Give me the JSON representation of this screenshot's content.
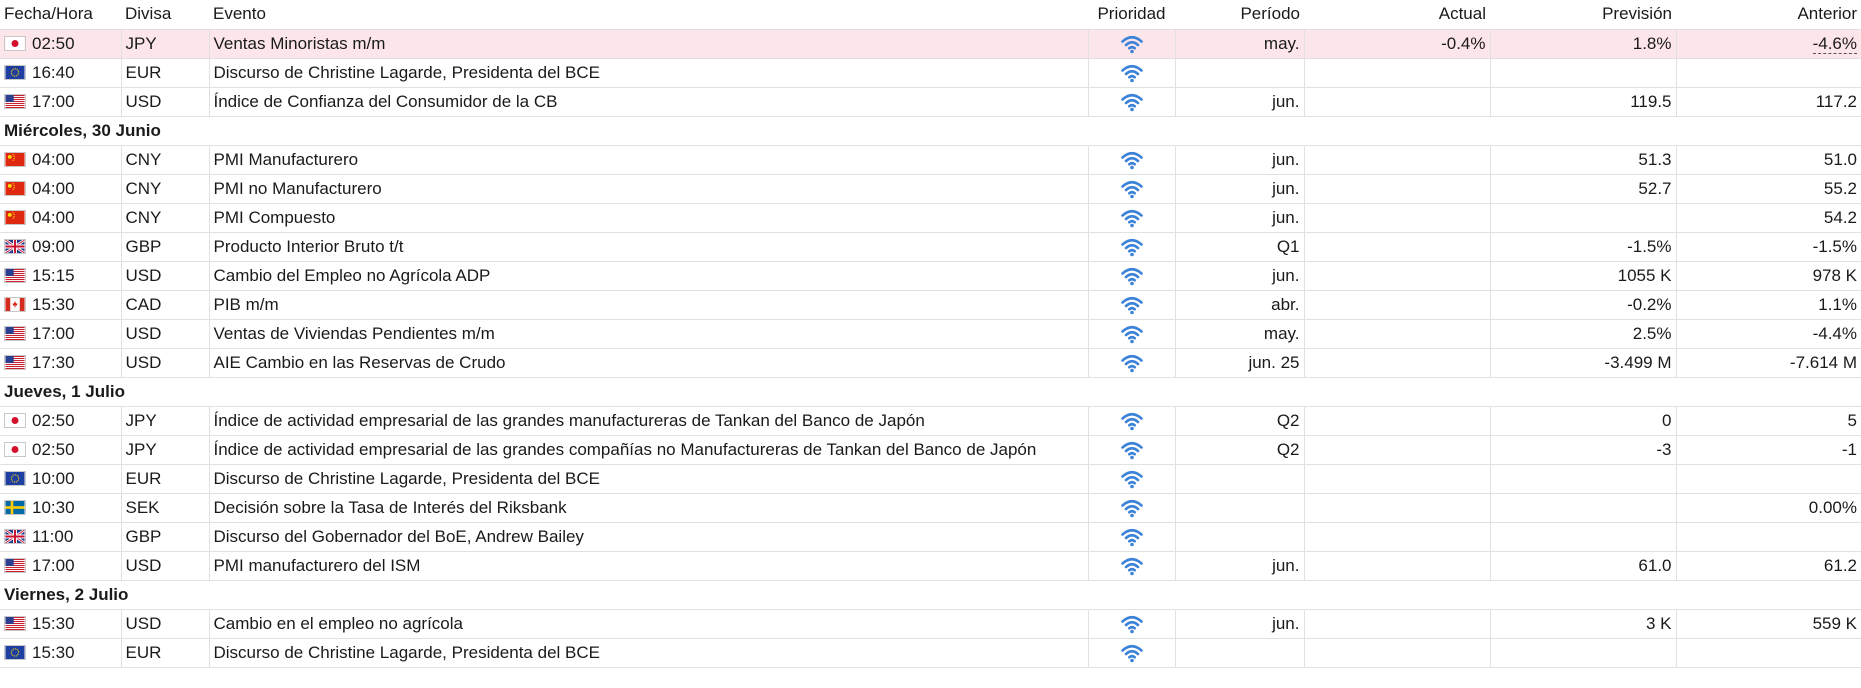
{
  "headers": {
    "datetime": "Fecha/Hora",
    "currency": "Divisa",
    "event": "Evento",
    "priority": "Prioridad",
    "period": "Período",
    "actual": "Actual",
    "forecast": "Previsión",
    "previous": "Anterior"
  },
  "colors": {
    "highlight_row": "#fde6ea",
    "priority_icon": "#3b82d8"
  },
  "rows": [
    {
      "type": "event",
      "flag": "jp",
      "time": "02:50",
      "currency": "JPY",
      "event": "Ventas Minoristas m/m",
      "period": "may.",
      "actual": "-0.4%",
      "forecast": "1.8%",
      "previous": "-4.6%",
      "highlight": true
    },
    {
      "type": "event",
      "flag": "eu",
      "time": "16:40",
      "currency": "EUR",
      "event": "Discurso de Christine Lagarde, Presidenta del BCE",
      "period": "",
      "actual": "",
      "forecast": "",
      "previous": ""
    },
    {
      "type": "event",
      "flag": "us",
      "time": "17:00",
      "currency": "USD",
      "event": "Índice de Confianza del Consumidor de la CB",
      "period": "jun.",
      "actual": "",
      "forecast": "119.5",
      "previous": "117.2"
    },
    {
      "type": "day",
      "label": "Miércoles, 30 Junio"
    },
    {
      "type": "event",
      "flag": "cn",
      "time": "04:00",
      "currency": "CNY",
      "event": "PMI Manufacturero",
      "period": "jun.",
      "actual": "",
      "forecast": "51.3",
      "previous": "51.0"
    },
    {
      "type": "event",
      "flag": "cn",
      "time": "04:00",
      "currency": "CNY",
      "event": "PMI no Manufacturero",
      "period": "jun.",
      "actual": "",
      "forecast": "52.7",
      "previous": "55.2"
    },
    {
      "type": "event",
      "flag": "cn",
      "time": "04:00",
      "currency": "CNY",
      "event": "PMI Compuesto",
      "period": "jun.",
      "actual": "",
      "forecast": "",
      "previous": "54.2"
    },
    {
      "type": "event",
      "flag": "gb",
      "time": "09:00",
      "currency": "GBP",
      "event": "Producto Interior Bruto t/t",
      "period": "Q1",
      "actual": "",
      "forecast": "-1.5%",
      "previous": "-1.5%"
    },
    {
      "type": "event",
      "flag": "us",
      "time": "15:15",
      "currency": "USD",
      "event": "Cambio del Empleo no Agrícola ADP",
      "period": "jun.",
      "actual": "",
      "forecast": "1055 K",
      "previous": "978 K"
    },
    {
      "type": "event",
      "flag": "ca",
      "time": "15:30",
      "currency": "CAD",
      "event": "PIB m/m",
      "period": "abr.",
      "actual": "",
      "forecast": "-0.2%",
      "previous": "1.1%"
    },
    {
      "type": "event",
      "flag": "us",
      "time": "17:00",
      "currency": "USD",
      "event": "Ventas de Viviendas Pendientes m/m",
      "period": "may.",
      "actual": "",
      "forecast": "2.5%",
      "previous": "-4.4%"
    },
    {
      "type": "event",
      "flag": "us",
      "time": "17:30",
      "currency": "USD",
      "event": "AIE Cambio en las Reservas de Crudo",
      "period": "jun. 25",
      "actual": "",
      "forecast": "-3.499 M",
      "previous": "-7.614 M"
    },
    {
      "type": "day",
      "label": "Jueves, 1 Julio"
    },
    {
      "type": "event",
      "flag": "jp",
      "time": "02:50",
      "currency": "JPY",
      "event": "Índice de actividad empresarial de las grandes manufactureras de Tankan del Banco de Japón",
      "period": "Q2",
      "actual": "",
      "forecast": "0",
      "previous": "5"
    },
    {
      "type": "event",
      "flag": "jp",
      "time": "02:50",
      "currency": "JPY",
      "event": "Índice de actividad empresarial de las grandes compañías no Manufactureras de Tankan del Banco de Japón",
      "period": "Q2",
      "actual": "",
      "forecast": "-3",
      "previous": "-1"
    },
    {
      "type": "event",
      "flag": "eu",
      "time": "10:00",
      "currency": "EUR",
      "event": "Discurso de Christine Lagarde, Presidenta del BCE",
      "period": "",
      "actual": "",
      "forecast": "",
      "previous": ""
    },
    {
      "type": "event",
      "flag": "se",
      "time": "10:30",
      "currency": "SEK",
      "event": "Decisión sobre la Tasa de Interés del Riksbank",
      "period": "",
      "actual": "",
      "forecast": "",
      "previous": "0.00%"
    },
    {
      "type": "event",
      "flag": "gb",
      "time": "11:00",
      "currency": "GBP",
      "event": "Discurso del Gobernador del BoE, Andrew Bailey",
      "period": "",
      "actual": "",
      "forecast": "",
      "previous": ""
    },
    {
      "type": "event",
      "flag": "us",
      "time": "17:00",
      "currency": "USD",
      "event": "PMI manufacturero del ISM",
      "period": "jun.",
      "actual": "",
      "forecast": "61.0",
      "previous": "61.2"
    },
    {
      "type": "day",
      "label": "Viernes, 2 Julio"
    },
    {
      "type": "event",
      "flag": "us",
      "time": "15:30",
      "currency": "USD",
      "event": "Cambio en el empleo no agrícola",
      "period": "jun.",
      "actual": "",
      "forecast": "3 K",
      "previous": "559 K"
    },
    {
      "type": "event",
      "flag": "eu",
      "time": "15:30",
      "currency": "EUR",
      "event": "Discurso de Christine Lagarde, Presidenta del BCE",
      "period": "",
      "actual": "",
      "forecast": "",
      "previous": ""
    }
  ]
}
